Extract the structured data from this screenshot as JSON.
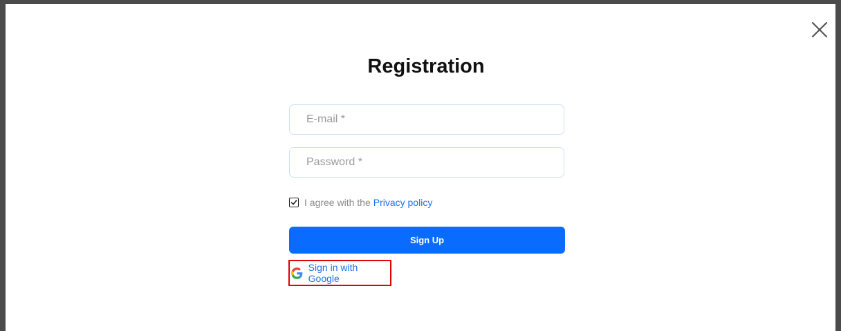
{
  "modal": {
    "title": "Registration",
    "close_icon": "close-icon"
  },
  "form": {
    "email_placeholder": "E-mail *",
    "email_value": "",
    "password_placeholder": "Password *",
    "password_value": "",
    "agree_checked": true,
    "agree_text": "I agree with the",
    "privacy_link": "Privacy policy",
    "signup_label": "Sign Up",
    "google_label": "Sign in with Google",
    "google_icon": "google-icon"
  },
  "colors": {
    "primary": "#0a6cff",
    "link": "#1a73e8",
    "highlight_border": "#e00000",
    "frame": "#4b4b4b"
  }
}
